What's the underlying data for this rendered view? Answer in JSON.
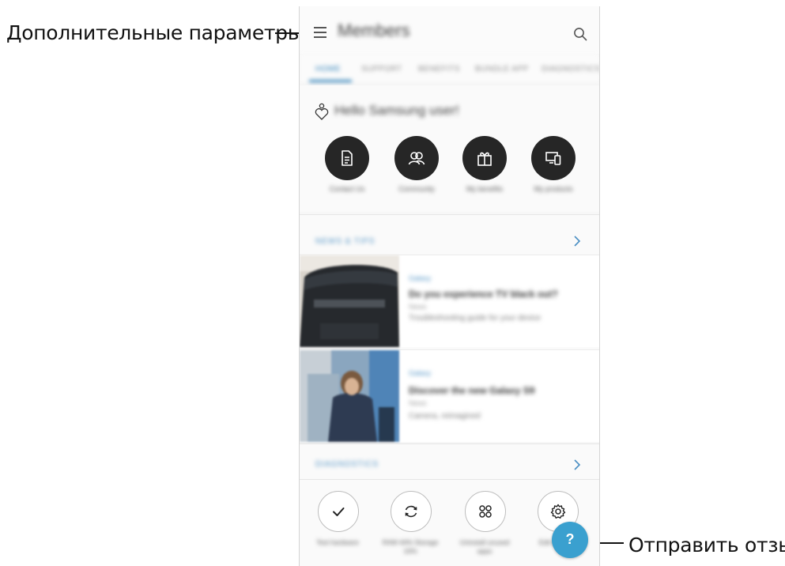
{
  "callouts": {
    "menu": "Дополнительные параметры",
    "feedback": "Отправить отзыв"
  },
  "app": {
    "title": "Members",
    "icons": {
      "menu": "hamburger-menu-icon",
      "search": "search-icon"
    }
  },
  "tabs": [
    {
      "label": "HOME",
      "active": true
    },
    {
      "label": "SUPPORT"
    },
    {
      "label": "BENEFITS"
    },
    {
      "label": "BUNDLE APP"
    },
    {
      "label": "DIAGNOSTICS"
    }
  ],
  "greeting": {
    "icon": "heart-sparkle-icon",
    "text": "Hello Samsung user!"
  },
  "quick_actions": [
    {
      "label": "Contact Us",
      "icon": "document-icon"
    },
    {
      "label": "Community",
      "icon": "community-icon"
    },
    {
      "label": "My benefits",
      "icon": "gift-icon"
    },
    {
      "label": "My products",
      "icon": "devices-icon"
    }
  ],
  "news": {
    "heading": "NEWS & TIPS",
    "articles": [
      {
        "category": "Galaxy",
        "title": "Do you experience TV black out?",
        "meta": "News",
        "desc": "Troubleshooting guide for your device"
      },
      {
        "category": "Galaxy",
        "title": "Discover the new Galaxy S9",
        "meta": "News",
        "desc": "Camera, reimagined"
      }
    ]
  },
  "diagnostics": {
    "heading": "DIAGNOSTICS",
    "items": [
      {
        "label": "Test hardware",
        "icon": "check-icon"
      },
      {
        "label": "RAM 44% Storage 16%",
        "icon": "refresh-icon"
      },
      {
        "label": "Uninstall unused apps",
        "icon": "apps-grid-icon"
      },
      {
        "label": "Edit settings",
        "icon": "gear-icon"
      }
    ]
  },
  "fab": {
    "label": "?",
    "icon": "help-question-icon"
  },
  "colors": {
    "accent": "#3aa0cf",
    "tab_active": "#2c7fb8",
    "action_button": "#262626"
  }
}
